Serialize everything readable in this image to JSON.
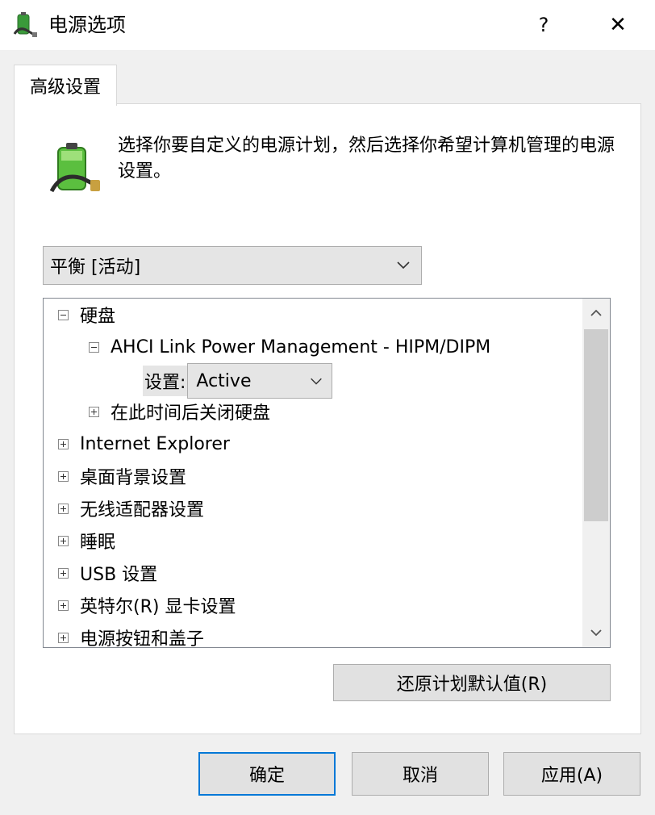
{
  "window": {
    "title": "电源选项",
    "help_label": "?",
    "close_label": "✕",
    "icon": "power-options-icon"
  },
  "tab": {
    "label": "高级设置"
  },
  "description": "选择你要自定义的电源计划，然后选择你希望计算机管理的电源设置。",
  "plan_select": {
    "value": "平衡 [活动]"
  },
  "tree": {
    "items": [
      {
        "label": "硬盘",
        "expanded": true
      },
      {
        "label": "AHCI Link Power Management - HIPM/DIPM",
        "expanded": true
      },
      {
        "label": "在此时间后关闭硬盘",
        "expanded": false
      },
      {
        "label": "Internet Explorer",
        "expanded": false
      },
      {
        "label": "桌面背景设置",
        "expanded": false
      },
      {
        "label": "无线适配器设置",
        "expanded": false
      },
      {
        "label": "睡眠",
        "expanded": false
      },
      {
        "label": "USB 设置",
        "expanded": false
      },
      {
        "label": "英特尔(R) 显卡设置",
        "expanded": false
      },
      {
        "label": "电源按钮和盖子",
        "expanded": false
      }
    ],
    "setting": {
      "label": "设置:",
      "value": "Active"
    }
  },
  "restore_button": "还原计划默认值(R)",
  "buttons": {
    "ok": "确定",
    "cancel": "取消",
    "apply": "应用(A)"
  }
}
